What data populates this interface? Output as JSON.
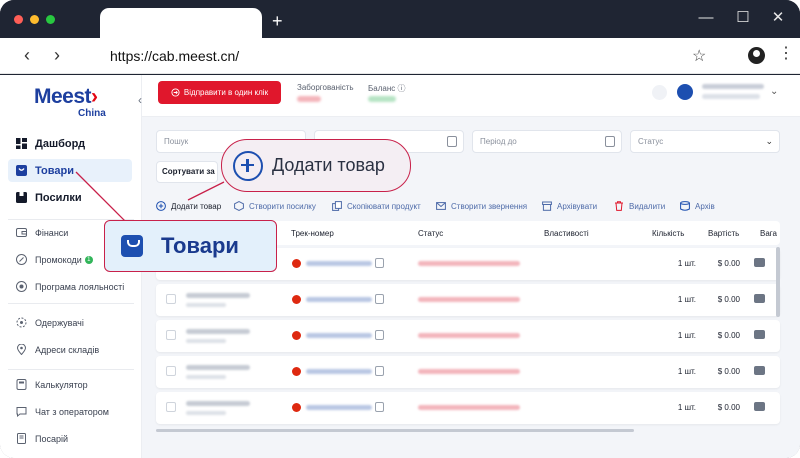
{
  "browser": {
    "url": "https://cab.meest.cn/",
    "new_tab": "+",
    "back": "‹",
    "forward": "›",
    "star": "☆",
    "kebab": "⋮",
    "minimize": "—",
    "maximize": "☐",
    "close": "✕"
  },
  "sidebar": {
    "logo_main": "Meest",
    "logo_accent": "›",
    "logo_sub": "China",
    "collapse": "‹",
    "primary": [
      {
        "label": "Дашборд",
        "icon": "dashboard-icon"
      },
      {
        "label": "Товари",
        "icon": "bag-icon"
      },
      {
        "label": "Посилки",
        "icon": "box-icon"
      }
    ],
    "group1": [
      {
        "label": "Фінанси",
        "icon": "wallet-icon"
      },
      {
        "label": "Промокоди",
        "icon": "percent-icon",
        "badge": "1"
      },
      {
        "label": "Програма лояльності",
        "icon": "loyalty-icon"
      }
    ],
    "group2": [
      {
        "label": "Одержувачі",
        "icon": "recipients-icon"
      },
      {
        "label": "Адреси складів",
        "icon": "location-icon"
      }
    ],
    "group3": [
      {
        "label": "Калькулятор",
        "icon": "calculator-icon"
      },
      {
        "label": "Чат з оператором",
        "icon": "chat-icon"
      },
      {
        "label": "Посарій",
        "icon": "book-icon"
      }
    ]
  },
  "header": {
    "send_button": "Відправити в один клік",
    "debt_label": "Заборгованість",
    "balance_label": "Баланс"
  },
  "filters": {
    "search_placeholder": "Пошук",
    "period_to_placeholder": "Період до",
    "status_placeholder": "Статус",
    "sort_label": "Сортувати за"
  },
  "toolbar": {
    "add": "Додати товар",
    "create_parcel": "Створити посилку",
    "copy_product": "Скопіювати продукт",
    "create_request": "Створити звернення",
    "archive": "Архівувати",
    "delete": "Видалити",
    "archive_view": "Архів"
  },
  "table": {
    "columns": [
      "Трек-номер",
      "Статус",
      "Властивості",
      "Кількість",
      "Вартість",
      "Вага"
    ],
    "rows": [
      {
        "qty": "1 шт.",
        "price": "$ 0.00"
      },
      {
        "qty": "1 шт.",
        "price": "$ 0.00"
      },
      {
        "qty": "1 шт.",
        "price": "$ 0.00"
      },
      {
        "qty": "1 шт.",
        "price": "$ 0.00"
      },
      {
        "qty": "1 шт.",
        "price": "$ 0.00"
      }
    ]
  },
  "callouts": {
    "add_product": "Додати товар",
    "goods": "Товари"
  },
  "colors": {
    "brand_blue": "#1d3f9f",
    "brand_red": "#e0172c",
    "callout_border": "#c8214a",
    "active_bg": "#e8f1fb"
  }
}
